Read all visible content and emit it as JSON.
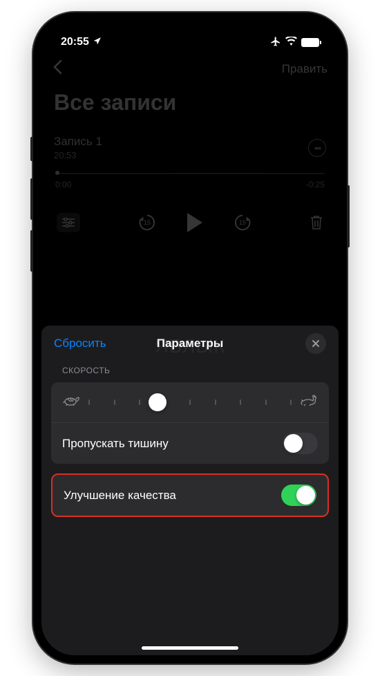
{
  "status_bar": {
    "time": "20:55",
    "location_icon": "location-arrow",
    "airplane_mode": true,
    "wifi": true,
    "battery": "full"
  },
  "nav": {
    "back": "‹",
    "edit": "Править"
  },
  "page_title": "Все записи",
  "recording": {
    "name": "Запись 1",
    "time": "20:53",
    "start": "0:00",
    "end": "-0:25",
    "skip_seconds": "15"
  },
  "sheet": {
    "reset": "Сбросить",
    "title": "Параметры",
    "watermark": "ЯБЛЫК",
    "speed_label": "СКОРОСТЬ",
    "skip_silence": "Пропускать тишину",
    "skip_silence_on": false,
    "enhance_quality": "Улучшение качества",
    "enhance_quality_on": true
  }
}
